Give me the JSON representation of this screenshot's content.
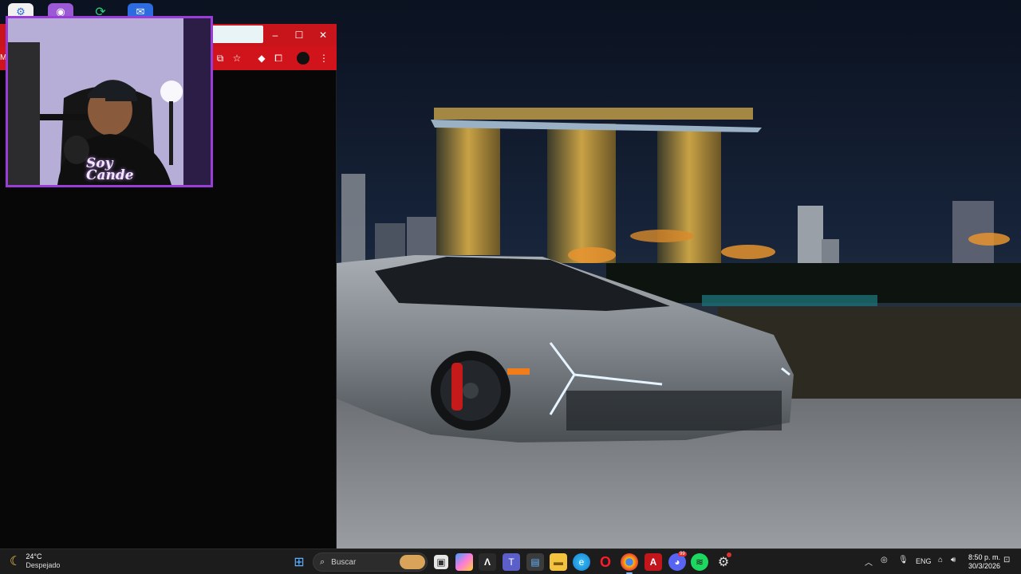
{
  "desktop": {
    "icons": [
      "app-icon-1",
      "podcast-icon",
      "refresh-icon",
      "mail-icon"
    ]
  },
  "browser": {
    "window_controls": {
      "minimize": "–",
      "maximize": "☐",
      "close": "✕"
    },
    "toolbar_icons": [
      "cast-icon",
      "bookmark-star-icon",
      "extension-diamond-icon",
      "extensions-puzzle-icon",
      "profile-avatar-icon",
      "menu-dots-icon"
    ],
    "title_fragment": "M"
  },
  "webcam": {
    "overlay_text_line1": "Soy",
    "overlay_text_line2": "Cande"
  },
  "taskbar": {
    "weather": {
      "temp": "24°C",
      "desc": "Despejado"
    },
    "search_placeholder": "Buscar",
    "apps": [
      "start-icon",
      "task-view-icon",
      "copilot-icon",
      "terminal-icon",
      "teams-icon",
      "store-icon",
      "file-explorer-icon",
      "edge-icon",
      "opera-icon",
      "chrome-icon",
      "acrobat-icon",
      "discord-icon",
      "spotify-icon",
      "settings-icon"
    ],
    "discord_badge": "99",
    "tray": {
      "lang": "ENG"
    },
    "clock": {
      "time": "8:50 p. m.",
      "date": "30/3/2026"
    }
  },
  "colors": {
    "browser_red": "#d1141b",
    "webcam_border": "#9a3cd8",
    "taskbar": "#1c1c1c"
  }
}
